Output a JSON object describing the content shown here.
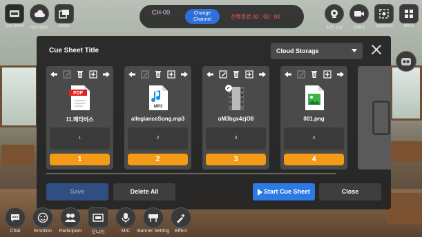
{
  "top_left": [
    {
      "label": "Cue Sheet",
      "icon": "cue-sheet-icon"
    },
    {
      "label": "개인저장소",
      "icon": "cloud-icon"
    },
    {
      "label": "Action",
      "icon": "action-icon"
    }
  ],
  "channel": {
    "name": "CH-00",
    "change_label": "Change Channel",
    "elapsed": "진행종료 00 : 00 : 00"
  },
  "top_right": [
    {
      "label": "화면 공유",
      "icon": "screen-share-icon"
    },
    {
      "label": "카메라",
      "icon": "camera-icon"
    },
    {
      "label": "Snapshot",
      "icon": "snapshot-icon"
    },
    {
      "label": "Menu",
      "icon": "menu-icon"
    }
  ],
  "modal": {
    "title": "Cue Sheet Title",
    "storage": "Cloud Storage",
    "cards": [
      {
        "file": "11.메타버스",
        "type": "pdf",
        "index": "1",
        "order": "1"
      },
      {
        "file": "allegianceSong.mp3",
        "type": "mp3",
        "index": "2",
        "order": "2"
      },
      {
        "file": "uM3bgx4zjO8",
        "type": "video",
        "index": "3",
        "order": "3"
      },
      {
        "file": "001.png",
        "type": "png",
        "index": "4",
        "order": "4"
      }
    ],
    "buttons": {
      "save": "Save",
      "delete_all": "Delete All",
      "start": "Start Cue Sheet",
      "close": "Close"
    },
    "file_badges": {
      "pdf": "PDF",
      "mp3": "MP3"
    }
  },
  "bottom": [
    {
      "label": "Chat",
      "icon": "chat-icon"
    },
    {
      "label": "Emotion",
      "icon": "emotion-icon"
    },
    {
      "label": "Participant",
      "icon": "participants-icon"
    },
    {
      "label": "모니터",
      "icon": "monitor-icon"
    },
    {
      "label": "MIC",
      "icon": "mic-icon"
    },
    {
      "label": "Banner Setting",
      "icon": "banner-icon"
    },
    {
      "label": "Effect",
      "icon": "effect-icon"
    }
  ]
}
